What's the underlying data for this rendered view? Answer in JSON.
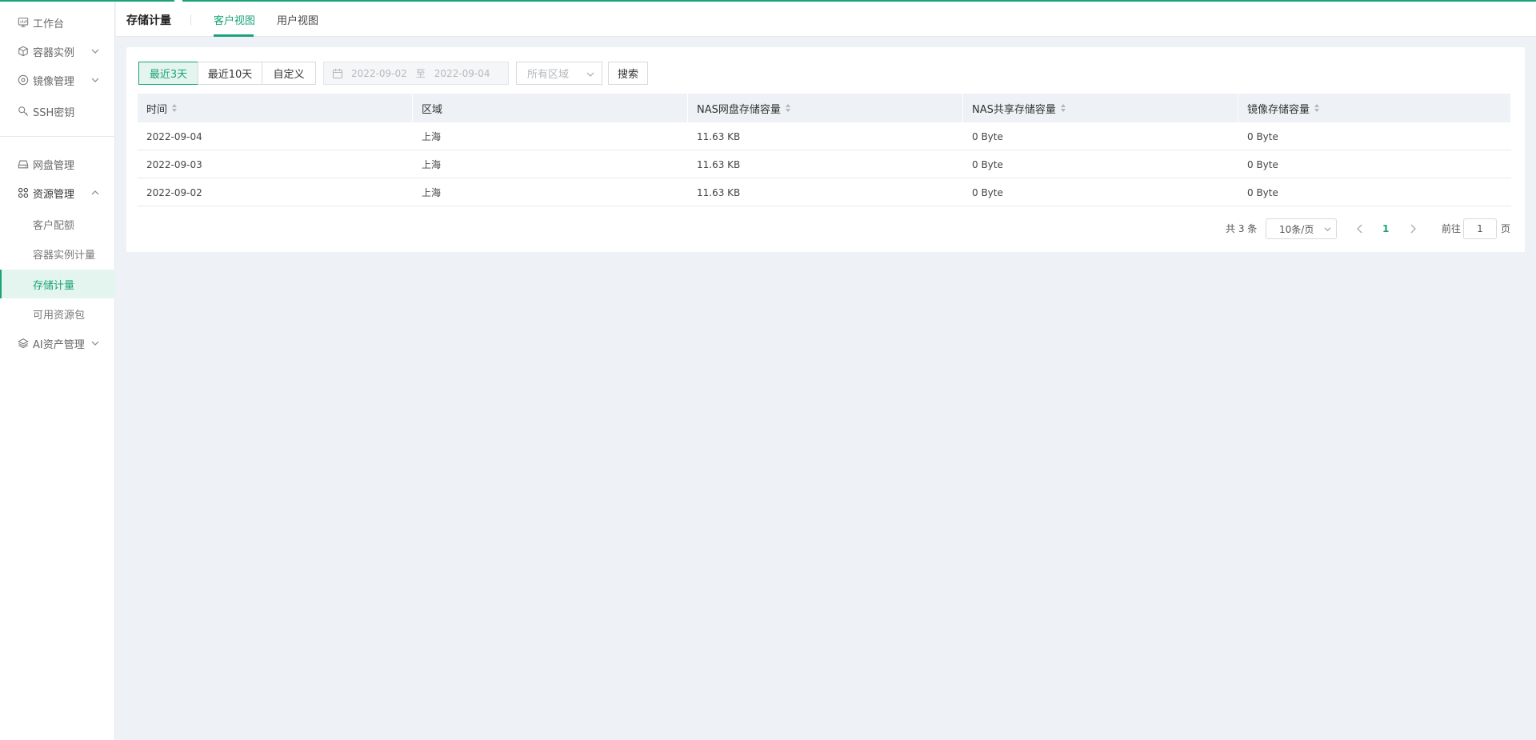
{
  "colors": {
    "accent": "#1aa37a",
    "background": "#eef1f5"
  },
  "sidebar": {
    "items": [
      {
        "label": "工作台",
        "icon": "dashboard-icon"
      },
      {
        "label": "容器实例",
        "icon": "cube-icon",
        "expandable": true
      },
      {
        "label": "镜像管理",
        "icon": "disc-icon",
        "expandable": true
      },
      {
        "label": "SSH密钥",
        "icon": "key-icon"
      },
      {
        "label": "网盘管理",
        "icon": "hard-drive-icon"
      },
      {
        "label": "资源管理",
        "icon": "grid-icon",
        "expanded": true
      },
      {
        "label": "AI资产管理",
        "icon": "layers-icon",
        "expandable": true
      }
    ],
    "sub_items": [
      {
        "label": "客户配额"
      },
      {
        "label": "容器实例计量"
      },
      {
        "label": "存储计量",
        "active": true
      },
      {
        "label": "可用资源包"
      }
    ]
  },
  "header": {
    "title": "存储计量",
    "tabs": [
      {
        "label": "客户视图",
        "active": true
      },
      {
        "label": "用户视图"
      }
    ]
  },
  "filters": {
    "range_buttons": [
      "最近3天",
      "最近10天",
      "自定义"
    ],
    "active_range": "最近3天",
    "date_start": "2022-09-02",
    "date_separator": "至",
    "date_end": "2022-09-04",
    "region_placeholder": "所有区域",
    "search_label": "搜索"
  },
  "table": {
    "columns": [
      "时间",
      "区域",
      "NAS网盘存储容量",
      "NAS共享存储容量",
      "镜像存储容量"
    ],
    "rows": [
      [
        "2022-09-04",
        "上海",
        "11.63 KB",
        "0 Byte",
        "0 Byte"
      ],
      [
        "2022-09-03",
        "上海",
        "11.63 KB",
        "0 Byte",
        "0 Byte"
      ],
      [
        "2022-09-02",
        "上海",
        "11.63 KB",
        "0 Byte",
        "0 Byte"
      ]
    ]
  },
  "pagination": {
    "total_label": "共 3 条",
    "page_size": "10条/页",
    "current_page": "1",
    "goto_prefix": "前往",
    "goto_value": "1",
    "goto_suffix": "页"
  }
}
